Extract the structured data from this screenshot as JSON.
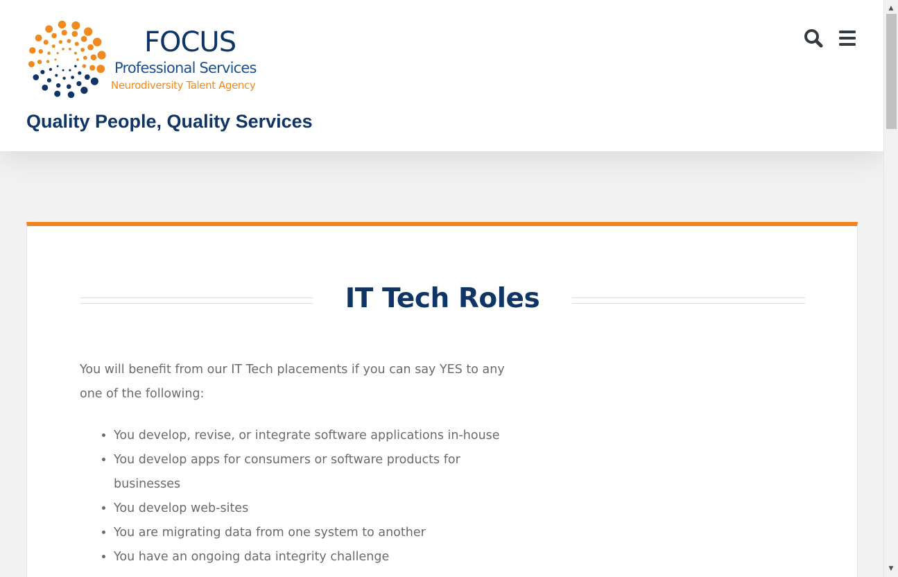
{
  "header": {
    "logo": {
      "brand": "FOCUS",
      "subtitle": "Professional Services",
      "descriptor": "Neurodiversity Talent Agency"
    },
    "tagline": "Quality People, Quality Services",
    "icons": {
      "search": "search-icon",
      "menu": "hamburger-menu-icon"
    }
  },
  "colors": {
    "navy": "#0f3466",
    "orange": "#f0851f",
    "body_text": "#6a6a6a",
    "background": "#f2f2f2"
  },
  "content": {
    "title": "IT Tech Roles",
    "intro": "You will benefit from our IT Tech placements if you can say YES to any one of the following:",
    "items": [
      "You develop, revise, or integrate software applications in-house",
      "You develop apps for consumers or software products for businesses",
      "You develop web-sites",
      "You are migrating data from one system to another",
      "You have an ongoing data integrity challenge"
    ]
  }
}
